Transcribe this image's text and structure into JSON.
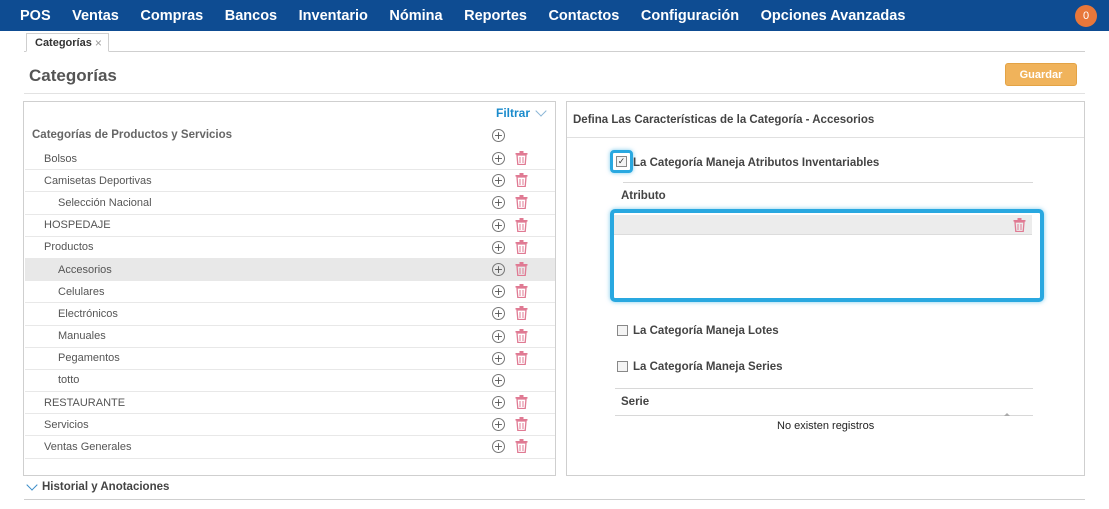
{
  "nav": {
    "items": [
      "POS",
      "Ventas",
      "Compras",
      "Bancos",
      "Inventario",
      "Nómina",
      "Reportes",
      "Contactos",
      "Configuración",
      "Opciones Avanzadas"
    ],
    "notification_count": "0"
  },
  "tab": {
    "label": "Categorías",
    "close": "×"
  },
  "page": {
    "title": "Categorías",
    "save_label": "Guardar"
  },
  "tree": {
    "filter_label": "Filtrar",
    "header": "Categorías de Productos y Servicios",
    "rows": [
      {
        "label": "Bolsos",
        "level": 1,
        "deletable": true
      },
      {
        "label": "Camisetas Deportivas",
        "level": 1,
        "deletable": true
      },
      {
        "label": "Selección Nacional",
        "level": 2,
        "deletable": true
      },
      {
        "label": "HOSPEDAJE",
        "level": 1,
        "deletable": true
      },
      {
        "label": "Productos",
        "level": 1,
        "deletable": true
      },
      {
        "label": "Accesorios",
        "level": 2,
        "deletable": true,
        "selected": true
      },
      {
        "label": "Celulares",
        "level": 2,
        "deletable": true
      },
      {
        "label": "Electrónicos",
        "level": 2,
        "deletable": true
      },
      {
        "label": "Manuales",
        "level": 2,
        "deletable": true
      },
      {
        "label": "Pegamentos",
        "level": 2,
        "deletable": true
      },
      {
        "label": "totto",
        "level": 2,
        "deletable": false
      },
      {
        "label": "RESTAURANTE",
        "level": 1,
        "deletable": true
      },
      {
        "label": "Servicios",
        "level": 1,
        "deletable": true
      },
      {
        "label": "Ventas Generales",
        "level": 1,
        "deletable": true
      }
    ]
  },
  "detail": {
    "title": "Defina Las Características de la Categoría  - Accesorios",
    "inventory_attr_label": "La Categoría Maneja Atributos Inventariables",
    "inventory_attr_checked": true,
    "attribute_header": "Atributo",
    "lots_label": "La Categoría Maneja Lotes",
    "lots_checked": false,
    "series_label": "La Categoría Maneja Series",
    "series_checked": false,
    "series_header": "Serie",
    "no_records": "No existen registros"
  },
  "history": {
    "label": "Historial y Anotaciones"
  },
  "colors": {
    "nav_bg": "#0e4c92",
    "accent": "#1a8bcc",
    "save_button": "#f0b35b",
    "delete_icon": "#e07a93",
    "highlight": "#29a8e0",
    "badge": "#e8773a"
  }
}
